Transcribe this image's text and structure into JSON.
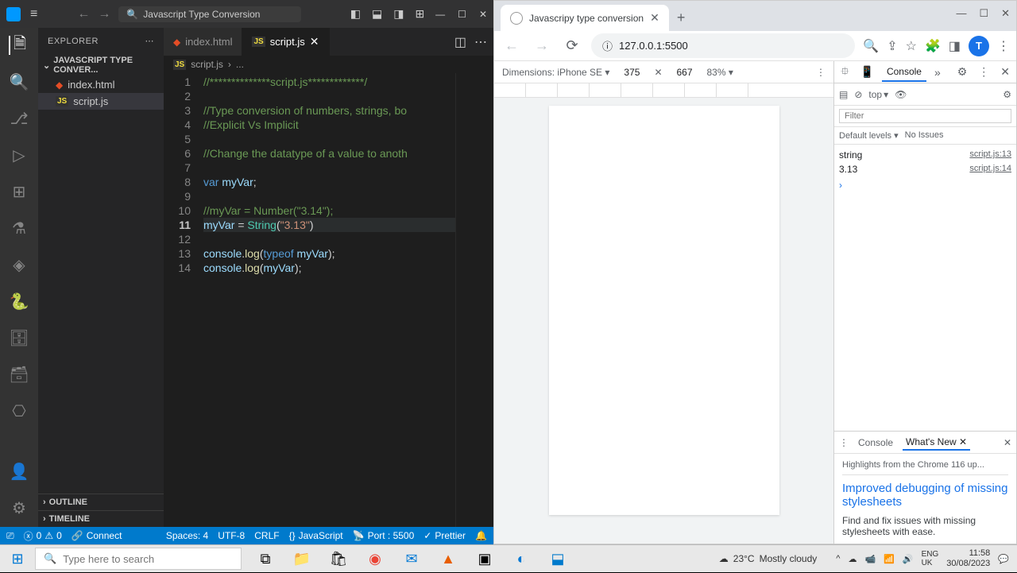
{
  "vscode": {
    "title": "Javascript Type Conversion",
    "explorer_label": "EXPLORER",
    "project_name": "JAVASCRIPT TYPE CONVER...",
    "files": [
      {
        "name": "index.html",
        "icon": "html"
      },
      {
        "name": "script.js",
        "icon": "js"
      }
    ],
    "outline_label": "OUTLINE",
    "timeline_label": "TIMELINE",
    "tabs": [
      {
        "label": "index.html",
        "icon": "html",
        "active": false
      },
      {
        "label": "script.js",
        "icon": "js",
        "active": true
      }
    ],
    "breadcrumb": {
      "file": "script.js",
      "sep": "›",
      "rest": "..."
    },
    "code_lines": [
      {
        "n": 1,
        "html": "<span class='c-comment'>//**************script.js*************/</span>"
      },
      {
        "n": 2,
        "html": ""
      },
      {
        "n": 3,
        "html": "<span class='c-comment'>//Type conversion of numbers, strings, bo</span>"
      },
      {
        "n": 4,
        "html": "<span class='c-comment'>//Explicit Vs Implicit</span>"
      },
      {
        "n": 5,
        "html": ""
      },
      {
        "n": 6,
        "html": "<span class='c-comment'>//Change the datatype of a value to anoth</span>"
      },
      {
        "n": 7,
        "html": ""
      },
      {
        "n": 8,
        "html": "<span class='c-keyword'>var</span> <span class='c-var'>myVar</span><span class='c-punct'>;</span>"
      },
      {
        "n": 9,
        "html": ""
      },
      {
        "n": 10,
        "html": "<span class='c-comment'>//myVar = Number(\"3.14\");</span>"
      },
      {
        "n": 11,
        "html": "<span class='c-var'>myVar</span> <span class='c-punct'>=</span> <span class='c-type'>String</span><span class='c-punct'>(</span><span class='c-string'>\"3.13\"</span><span class='c-punct'>)</span>",
        "current": true
      },
      {
        "n": 12,
        "html": ""
      },
      {
        "n": 13,
        "html": "<span class='c-var'>console</span><span class='c-punct'>.</span><span class='c-func'>log</span><span class='c-punct'>(</span><span class='c-keyword'>typeof</span> <span class='c-var'>myVar</span><span class='c-punct'>);</span>"
      },
      {
        "n": 14,
        "html": "<span class='c-var'>console</span><span class='c-punct'>.</span><span class='c-func'>log</span><span class='c-punct'>(</span><span class='c-var'>myVar</span><span class='c-punct'>);</span>"
      }
    ],
    "status": {
      "errors": "0",
      "warnings": "0",
      "connect": "Connect",
      "spaces": "Spaces: 4",
      "encoding": "UTF-8",
      "eol": "CRLF",
      "language": "JavaScript",
      "port": "Port : 5500",
      "prettier": "Prettier"
    }
  },
  "browser": {
    "tab_title": "Javascripy type conversion",
    "url": "127.0.0.1:5500",
    "device": {
      "label": "Dimensions: iPhone SE",
      "width": "375",
      "height": "667",
      "zoom": "83%"
    },
    "devtools": {
      "console_tab": "Console",
      "context": "top",
      "filter_placeholder": "Filter",
      "levels": "Default levels",
      "issues": "No Issues",
      "logs": [
        {
          "value": "string",
          "source": "script.js:13"
        },
        {
          "value": "3.13",
          "source": "script.js:14"
        }
      ],
      "drawer": {
        "console": "Console",
        "whatsnew": "What's New",
        "highlight": "Highlights from the Chrome 116 up...",
        "heading": "Improved debugging of missing stylesheets",
        "body": "Find and fix issues with missing stylesheets with ease."
      }
    }
  },
  "taskbar": {
    "search_placeholder": "Type here to search",
    "weather_temp": "23°C",
    "weather_desc": "Mostly cloudy",
    "lang": "ENG\nUK",
    "time": "11:58",
    "date": "30/08/2023"
  }
}
